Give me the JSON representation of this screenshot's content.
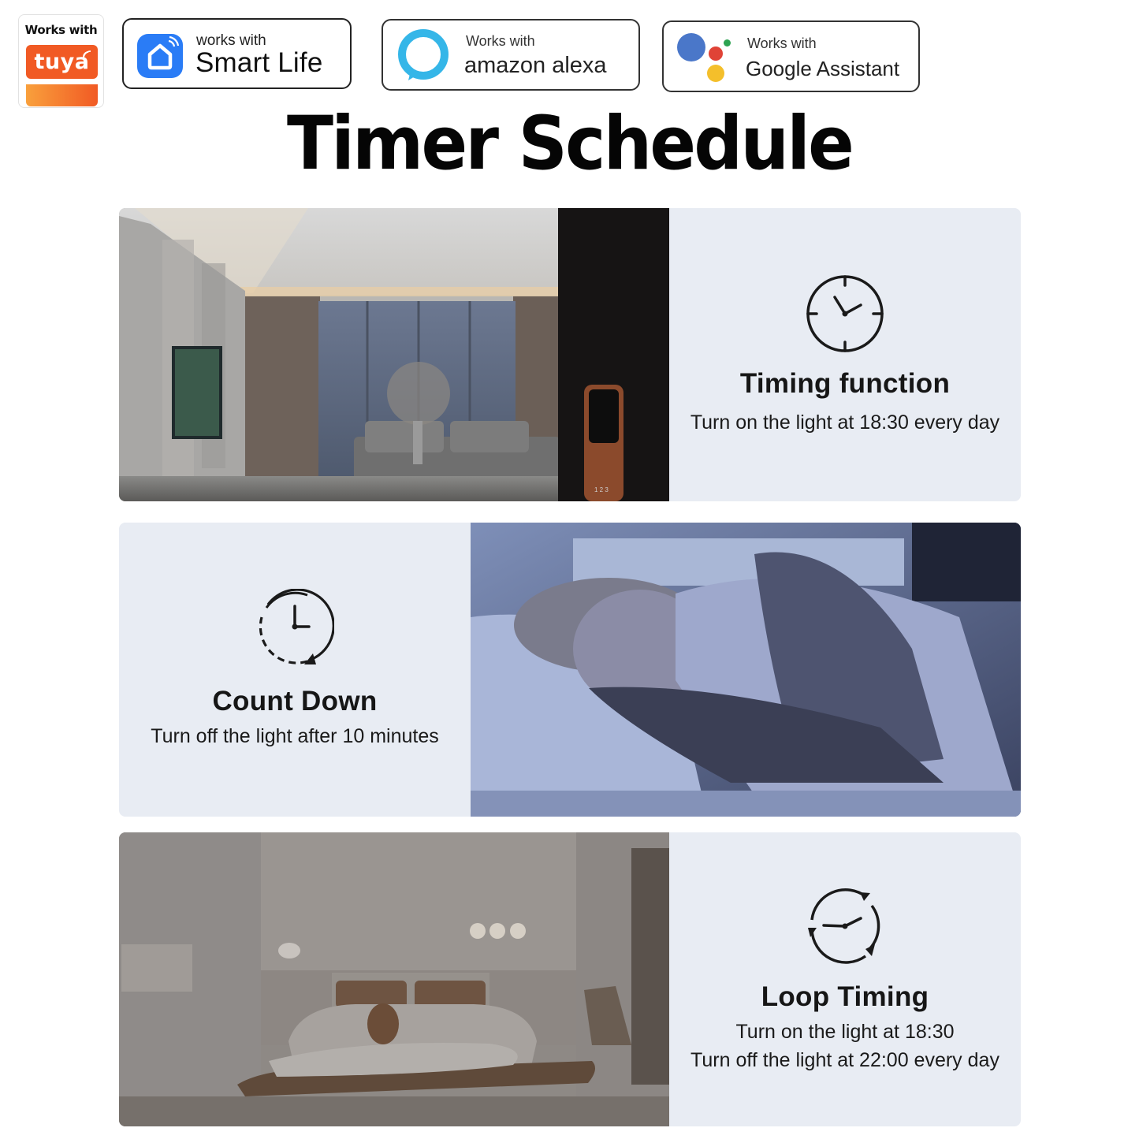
{
  "badges": {
    "tuya": {
      "works_with": "Works with",
      "brand": "tuya",
      "brand_color": "#f15a24"
    },
    "smart_life": {
      "works_with": "works with",
      "brand": "Smart Life",
      "icon": "home-wifi-icon",
      "icon_color": "#2a7cf6"
    },
    "alexa": {
      "works_with": "Works with",
      "brand": "amazon alexa",
      "icon": "alexa-ring-icon",
      "icon_color": "#35b6e8"
    },
    "google": {
      "works_with": "Works with",
      "brand": "Google Assistant",
      "icon": "google-assistant-dots-icon",
      "dot_colors": [
        "#4a77c9",
        "#e04336",
        "#2ea352",
        "#f4bf2b"
      ]
    }
  },
  "title": "Timer Schedule",
  "features": [
    {
      "title": "Timing function",
      "icon": "clock-icon",
      "lines": [
        "Turn on the light at 18:30 every day"
      ],
      "image": "living-room-photo"
    },
    {
      "title": "Count Down",
      "icon": "countdown-clock-icon",
      "lines": [
        "Turn off the light after 10 minutes"
      ],
      "image": "sleeping-woman-photo"
    },
    {
      "title": "Loop Timing",
      "icon": "loop-clock-icon",
      "lines": [
        "Turn on the light at 18:30",
        "Turn off the light at 22:00 every day"
      ],
      "image": "bedroom-photo"
    }
  ],
  "colors": {
    "panel_bg": "#e8ecf3",
    "text": "#161616"
  }
}
